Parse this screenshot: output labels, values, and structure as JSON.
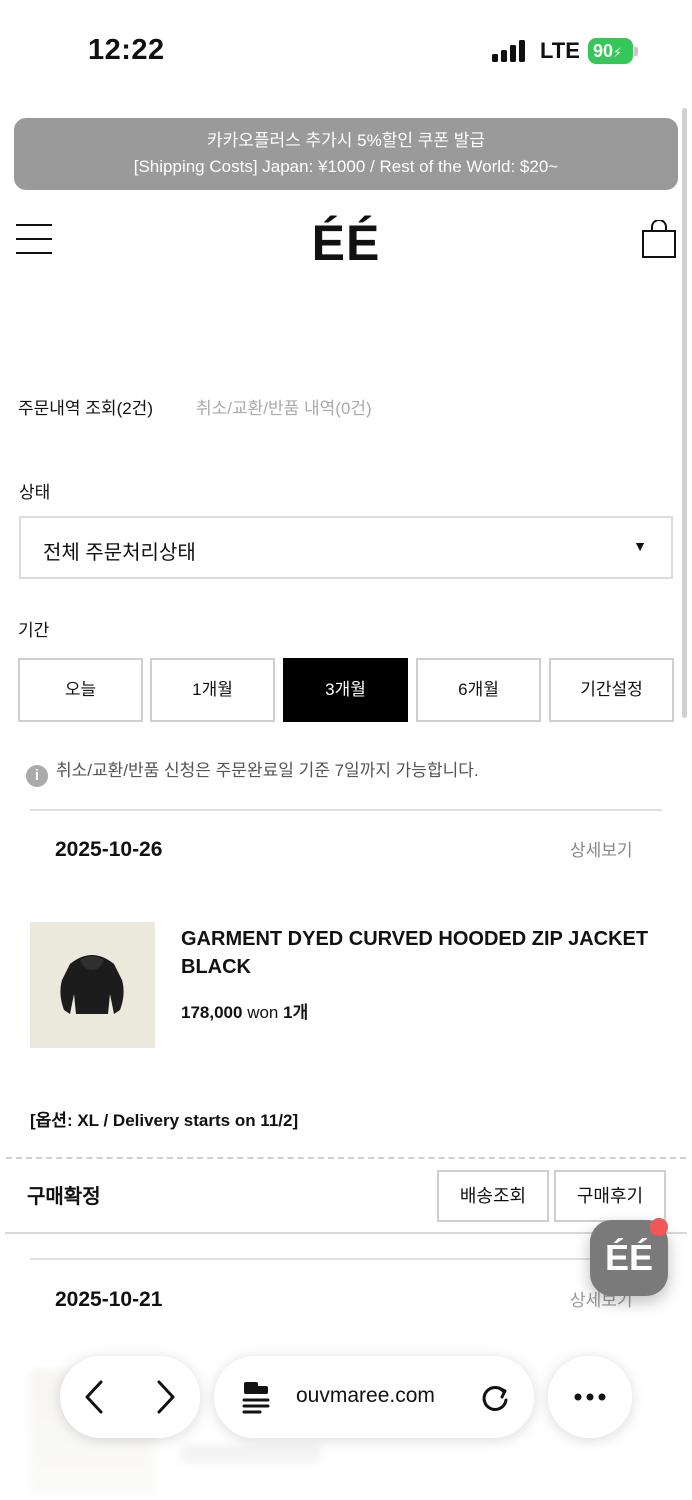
{
  "status_bar": {
    "time": "12:22",
    "network": "LTE",
    "battery": "90"
  },
  "banner": {
    "line1": "카카오플러스 추가시 5%할인 쿠폰 발급",
    "line2": "[Shipping Costs] Japan: ¥1000 / Rest of the World: $20~"
  },
  "header": {
    "logo": "ÉÉ"
  },
  "tabs": {
    "orders": "주문내역 조회(2건)",
    "returns": "취소/교환/반품 내역(0건)"
  },
  "filters": {
    "status_label": "상태",
    "status_value": "전체 주문처리상태",
    "period_label": "기간",
    "periods": [
      "오늘",
      "1개월",
      "3개월",
      "6개월",
      "기간설정"
    ],
    "active_period": "3개월"
  },
  "notice": "취소/교환/반품 신청은 주문완료일 기준 7일까지 가능합니다.",
  "orders": [
    {
      "date": "2025-10-26",
      "detail_label": "상세보기",
      "product_name": "GARMENT DYED CURVED HOODED ZIP JACKET BLACK",
      "price": "178,000",
      "currency": "won",
      "quantity": "1개",
      "option": "[옵션: XL / Delivery starts on 11/2]",
      "status": "구매확정",
      "actions": [
        "배송조회",
        "구매후기"
      ]
    },
    {
      "date": "2025-10-21",
      "detail_label": "상세보기"
    }
  ],
  "fab": {
    "label": "ÉÉ"
  },
  "browser": {
    "url": "ouvmaree.com"
  },
  "icons": [
    "signal-icon",
    "battery-icon",
    "hamburger-icon",
    "shopping-bag-icon",
    "info-icon",
    "back-icon",
    "forward-icon",
    "page-menu-icon",
    "reload-icon",
    "more-icon"
  ]
}
